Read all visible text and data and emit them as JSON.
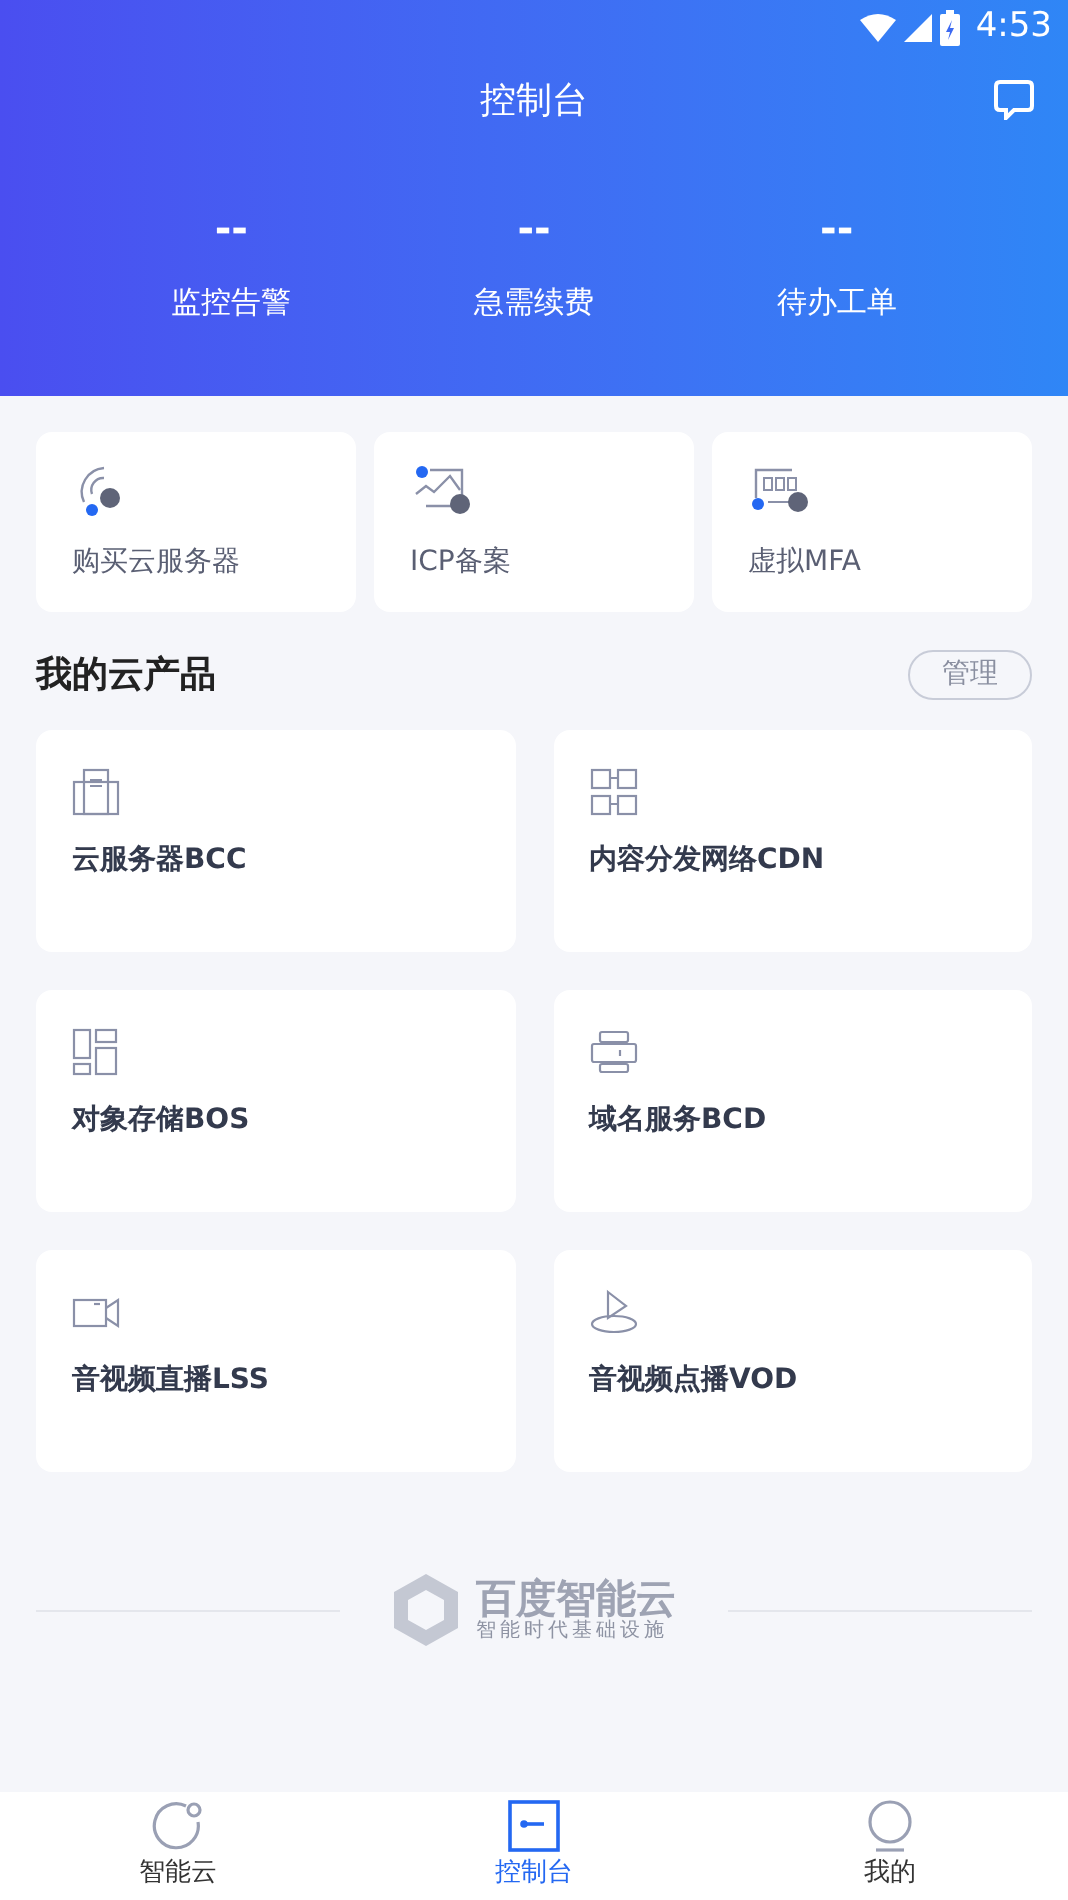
{
  "status_bar": {
    "time": "4:53"
  },
  "header": {
    "title": "控制台"
  },
  "stats": [
    {
      "value": "--",
      "label": "监控告警"
    },
    {
      "value": "--",
      "label": "急需续费"
    },
    {
      "value": "--",
      "label": "待办工单"
    }
  ],
  "quick_actions": [
    {
      "kind": "server",
      "label": "购买云服务器"
    },
    {
      "kind": "icp",
      "label": "ICP备案"
    },
    {
      "kind": "mfa",
      "label": "虚拟MFA"
    }
  ],
  "products_section": {
    "title": "我的云产品",
    "manage_button": "管理"
  },
  "products": [
    {
      "kind": "bcc",
      "name": "云服务器BCC"
    },
    {
      "kind": "cdn",
      "name": "内容分发网络CDN"
    },
    {
      "kind": "bos",
      "name": "对象存储BOS"
    },
    {
      "kind": "bcd",
      "name": "域名服务BCD"
    },
    {
      "kind": "lss",
      "name": "音视频直播LSS"
    },
    {
      "kind": "vod",
      "name": "音视频点播VOD"
    }
  ],
  "footer": {
    "logo_text": "百度智能云",
    "slogan": "智能时代基础设施"
  },
  "tab_bar": [
    {
      "kind": "cloud",
      "label": "智能云",
      "selected": false
    },
    {
      "kind": "console",
      "label": "控制台",
      "selected": true
    },
    {
      "kind": "me",
      "label": "我的",
      "selected": false
    }
  ]
}
